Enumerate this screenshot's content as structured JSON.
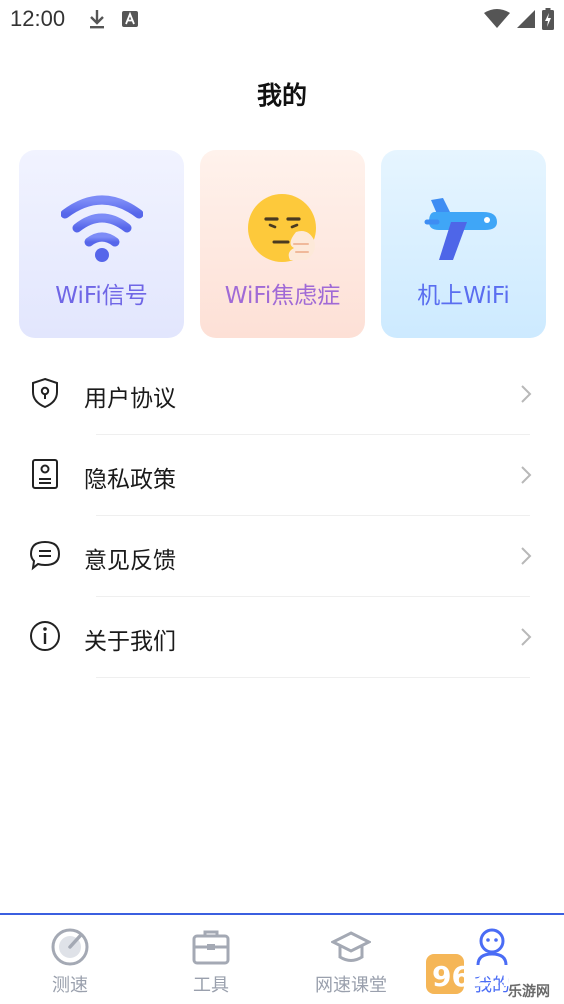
{
  "status_bar": {
    "time": "12:00",
    "icons": [
      "download-icon",
      "a-notification-icon",
      "wifi-signal-icon",
      "cell-signal-icon",
      "battery-charging-icon"
    ]
  },
  "page": {
    "title": "我的"
  },
  "feature_cards": [
    {
      "label": "WiFi信号",
      "icon": "wifi-icon",
      "color": "#6f66e6"
    },
    {
      "label": "WiFi焦虑症",
      "icon": "anxious-face-icon",
      "color": "#a06ad6"
    },
    {
      "label": "机上WiFi",
      "icon": "airplane-icon",
      "color": "#5a6ef0"
    }
  ],
  "menu": {
    "items": [
      {
        "label": "用户协议",
        "icon": "shield-lock-icon"
      },
      {
        "label": "隐私政策",
        "icon": "document-icon"
      },
      {
        "label": "意见反馈",
        "icon": "chat-bubble-icon"
      },
      {
        "label": "关于我们",
        "icon": "info-icon"
      }
    ]
  },
  "bottom_nav": {
    "items": [
      {
        "label": "测速",
        "icon": "speedometer-icon",
        "active": false
      },
      {
        "label": "工具",
        "icon": "toolbox-icon",
        "active": false
      },
      {
        "label": "网速课堂",
        "icon": "graduation-cap-icon",
        "active": false
      },
      {
        "label": "我的",
        "icon": "user-robot-icon",
        "active": true
      }
    ],
    "active_color": "#4a6cf5",
    "inactive_color": "#9aa0ad"
  },
  "watermark": {
    "text": "962.NET",
    "subtext": "乐游网"
  }
}
